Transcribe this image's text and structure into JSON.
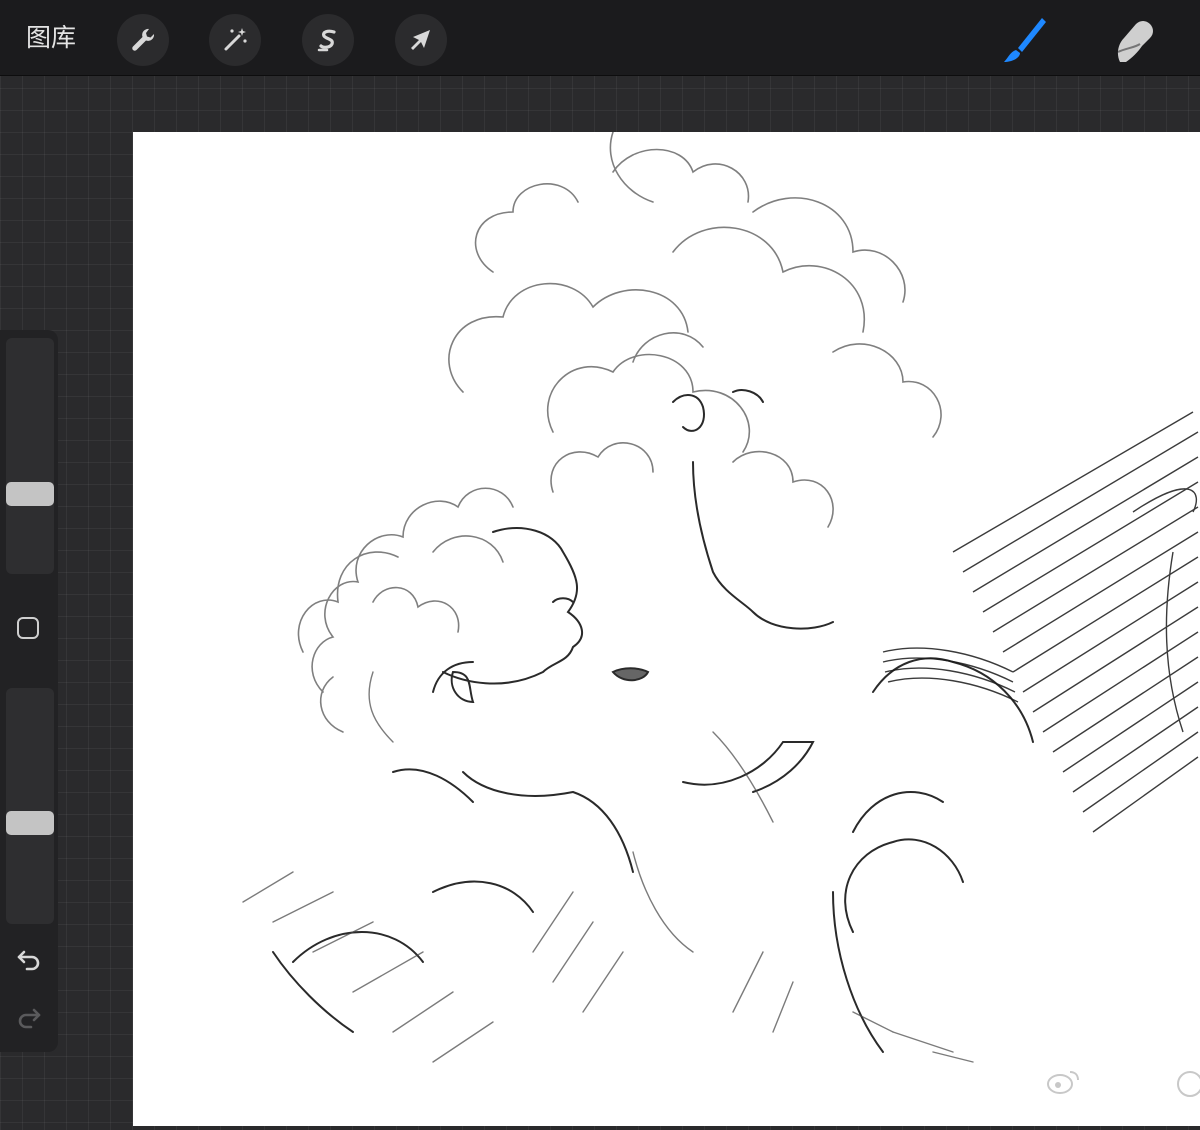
{
  "toolbar": {
    "gallery_label": "图库",
    "left_tools": [
      {
        "name": "actions",
        "icon": "wrench-icon"
      },
      {
        "name": "adjustments",
        "icon": "magic-wand-icon"
      },
      {
        "name": "selection",
        "icon": "selection-s-icon"
      },
      {
        "name": "transform",
        "icon": "arrow-cursor-icon"
      }
    ],
    "right_tools": [
      {
        "name": "brush",
        "icon": "brush-icon",
        "active": true,
        "color": "#1e88ff"
      },
      {
        "name": "smudge",
        "icon": "smudge-finger-icon",
        "active": false
      }
    ]
  },
  "sidebar": {
    "brush_size_level": 0.32,
    "opacity_level": 0.42,
    "modify_button": "square-icon",
    "undo": "undo-icon",
    "redo": "redo-icon"
  },
  "canvas": {
    "content": "pencil-sketch-artwork",
    "background": "#ffffff"
  },
  "watermark": {
    "icon": "weibo-logo-icon"
  },
  "colors": {
    "toolbar_bg": "#1b1b1d",
    "workspace_bg": "#2a2a2c",
    "active_tool": "#1e88ff",
    "slider_thumb": "#c4c4c4"
  }
}
